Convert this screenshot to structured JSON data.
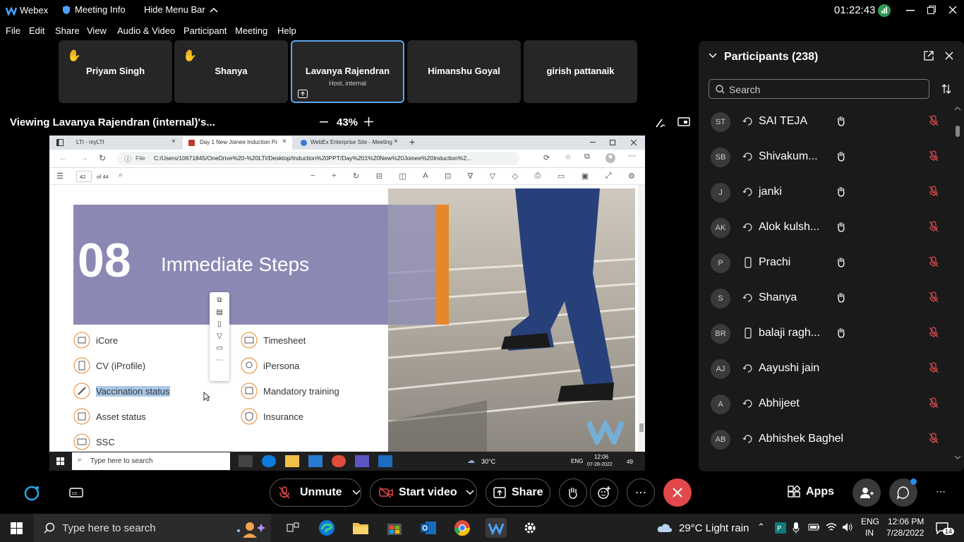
{
  "titlebar": {
    "app": "Webex",
    "meeting_info": "Meeting Info",
    "hide_menu": "Hide Menu Bar",
    "clock": "01:22:43"
  },
  "menu": [
    "File",
    "Edit",
    "Share",
    "View",
    "Audio & Video",
    "Participant",
    "Meeting",
    "Help"
  ],
  "tiles": [
    {
      "name": "Priyam Singh",
      "hand": true
    },
    {
      "name": "Shanya",
      "hand": true
    },
    {
      "name": "Lavanya Rajendran",
      "sub": "Host, internal",
      "active": true
    },
    {
      "name": "Himanshu Goyal"
    },
    {
      "name": "girish pattanaik"
    }
  ],
  "share": {
    "viewing": "Viewing Lavanya Rajendran (internal)'s...",
    "zoom": "43%"
  },
  "browser": {
    "tabs": [
      "LTI - myLTI",
      "Day 1 New Joinee Induction Pack",
      "WebEx Enterprise Site - Meeting"
    ],
    "url_label": "File",
    "url": "C:/Users/10671845/OneDrive%20-%20LTI/Desktop/Induction%20PPT/Day%201%20New%20Joinee%20Induction%2...",
    "page": "42",
    "of": "of 44"
  },
  "slide": {
    "number": "08",
    "title": "Immediate Steps",
    "left_items": [
      "iCore",
      "CV (iProfile)",
      "Vaccination status",
      "Asset status",
      "SSC"
    ],
    "right_items": [
      "Timesheet",
      "iPersona",
      "Mandatory training",
      "Insurance"
    ]
  },
  "remote_taskbar": {
    "search": "Type here to search",
    "temp": "30°C",
    "lang": "ENG",
    "time": "12:06",
    "date": "07-28-2022",
    "badge": "49"
  },
  "controls": {
    "unmute": "Unmute",
    "start_video": "Start video",
    "share": "Share",
    "apps": "Apps"
  },
  "panel": {
    "title": "Participants (238)",
    "search_placeholder": "Search",
    "participants": [
      {
        "initials": "ST",
        "name": "SAI TEJA",
        "device": "sync",
        "hand": true
      },
      {
        "initials": "SB",
        "name": "Shivakum...",
        "device": "sync",
        "hand": true
      },
      {
        "initials": "J",
        "name": "janki",
        "device": "sync",
        "hand": true
      },
      {
        "initials": "AK",
        "name": "Alok kulsh...",
        "device": "sync",
        "hand": true
      },
      {
        "initials": "P",
        "name": "Prachi",
        "device": "phone",
        "hand": true
      },
      {
        "initials": "S",
        "name": "Shanya",
        "device": "sync",
        "hand": true
      },
      {
        "initials": "BR",
        "name": "balaji ragh...",
        "device": "phone",
        "hand": true
      },
      {
        "initials": "AJ",
        "name": "Aayushi jain",
        "device": "sync",
        "hand": false
      },
      {
        "initials": "A",
        "name": "Abhijeet",
        "device": "sync",
        "hand": false
      },
      {
        "initials": "AB",
        "name": "Abhishek Baghel",
        "device": "sync",
        "hand": false
      }
    ]
  },
  "taskbar": {
    "search": "Type here to search",
    "weather": "29°C  Light rain",
    "lang1": "ENG",
    "lang2": "IN",
    "time": "12:06 PM",
    "date": "7/28/2022",
    "notif": "14"
  }
}
